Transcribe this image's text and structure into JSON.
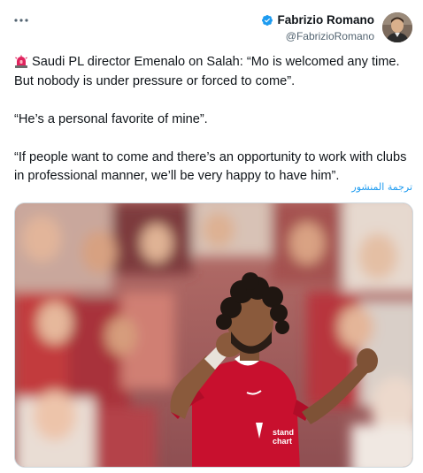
{
  "author": {
    "display_name": "Fabrizio Romano",
    "handle": "@FabrizioRomano",
    "verified": true,
    "avatar_icon": "profile-photo"
  },
  "menu": {
    "icon": "more-horizontal-icon"
  },
  "tweet": {
    "siren_icon": "police-light-emoji",
    "paragraph_1": "Saudi PL director Emenalo on Salah: “Mo is welcomed any time. But nobody is under pressure or forced to come”.",
    "paragraph_2": "“He’s a personal favorite of mine”.",
    "paragraph_3": "“If people want to come and there’s an opportunity to work with clubs in professional manner, we’ll be very happy to have him”."
  },
  "translate_label": "ترجمة المنشور",
  "media": {
    "shirt_text": "stand chart",
    "description_icon": "football-player-celebrating-photo"
  },
  "colors": {
    "link": "#1d9bf0",
    "verified_badge": "#1d9bf0",
    "secondary_text": "#536471",
    "jersey_red": "#c8102e"
  }
}
